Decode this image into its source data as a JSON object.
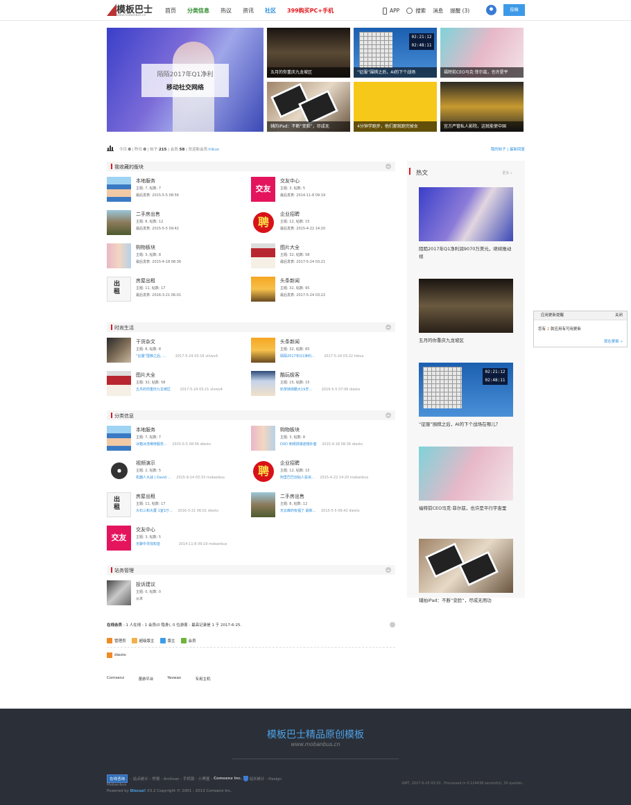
{
  "header": {
    "logo_text": "模板巴士",
    "logo_sub": "www.mobanbus.cn",
    "nav": [
      {
        "label": "首页",
        "style": "normal"
      },
      {
        "label": "分类信息",
        "style": "green"
      },
      {
        "label": "热议",
        "style": "normal"
      },
      {
        "label": "资讯",
        "style": "normal"
      },
      {
        "label": "社区",
        "style": "blue"
      },
      {
        "label": "399购买PC+手机",
        "style": "red"
      }
    ],
    "app_label": "APP",
    "search_label": "搜索",
    "messages_label": "消息",
    "remind_label": "提醒 (3)",
    "post_button": "投稿"
  },
  "hero": {
    "line1": "陌陌2017年Q1净利",
    "line2": "移动社交网络"
  },
  "thumbs": [
    {
      "caption": "五月的你重庆九龙坡区"
    },
    {
      "caption": "“征服”围棋之后，AI的下个战场",
      "clock": "02:21:12",
      "clock2": "02:48:11"
    },
    {
      "caption": "福特前CEO马克·菲尔兹，也许是平"
    },
    {
      "caption": "辅的iPad：不断“变脸”，尽成无"
    },
    {
      "caption": "4分钟学跑步，他们那就跑完掉女"
    },
    {
      "caption": "宜方严管私人影院，这就能使中国"
    }
  ],
  "stats": {
    "today_label": "今日:",
    "today": "0",
    "yesterday_label": "昨日:",
    "yesterday": "0",
    "posts_label": "帖子:",
    "posts": "215",
    "members_label": "会员:",
    "members": "58",
    "welcome_label": "欢迎新会员:",
    "new_member": "hibus",
    "my_posts": "我的帖子",
    "latest_reply": "最新回复"
  },
  "sections": {
    "favorites": {
      "title": "我收藏的版块",
      "forums": [
        {
          "name": "本地服务",
          "meta": "主题: 7, 帖数: 7",
          "meta2": "最后发表: 2015-5-5 08:56"
        },
        {
          "name": "交友中心",
          "meta": "主题: 3, 帖数: 5",
          "meta2": "最后发表: 2014-11-8 09:19"
        },
        {
          "name": "二手房出售",
          "meta": "主题: 8, 帖数: 12",
          "meta2": "最后发表: 2015-5-5 09:42"
        },
        {
          "name": "企业招聘",
          "meta": "主题: 12, 帖数: 15",
          "meta2": "最后发表: 2015-4-22 14:20"
        },
        {
          "name": "购物板块",
          "meta": "主题: 3, 帖数: 8",
          "meta2": "最后发表: 2015-4-18 08:36"
        },
        {
          "name": "图片大全",
          "meta": "主题: 32, 帖数: 58",
          "meta2": "最后发表: 2017-5-24 03:21"
        },
        {
          "name": "房屋出租",
          "meta": "主题: 11, 帖数: 17",
          "meta2": "最后发表: 2016-3-21 06:01"
        },
        {
          "name": "头条新闻",
          "meta": "主题: 32, 帖数: 65",
          "meta2": "最后发表: 2017-5-24 03:22"
        }
      ]
    },
    "fashion": {
      "title": "时尚生活",
      "forums": [
        {
          "name": "干货杂文",
          "meta": "主题: 8, 帖数: 8",
          "link": "“征服”围棋之后, ...",
          "info": "2017-5-24 03:16 vlivev4"
        },
        {
          "name": "头条新闻",
          "meta": "主题: 32, 帖数: 65",
          "link": "陌陌2017年Q1净利...",
          "info": "2017-5-24 03:22 hibus"
        },
        {
          "name": "图片大全",
          "meta": "主题: 32, 帖数: 58",
          "link": "五月的你重庆九龙坡区",
          "info": "2017-5-24 03:21 vlivev4"
        },
        {
          "name": "酷玩极客",
          "meta": "主题: 15, 帖数: 15",
          "link": "奶茶妹妹酷大19岁...",
          "info": "2016-5-5 07:06 diesto"
        }
      ]
    },
    "classified": {
      "title": "分类信息",
      "forums": [
        {
          "name": "本地服务",
          "meta": "主题: 7, 帖数: 7",
          "link": "冰箱冰洗维修服务...",
          "info": "2015-5-5 08:56 diesto"
        },
        {
          "name": "购物板块",
          "meta": "主题: 3, 帖数: 8",
          "link": "DVD 刺绣拼接连帽外套",
          "info": "2015-4-18 08:36 diesto"
        },
        {
          "name": "视频演示",
          "meta": "主题: 2, 帖数: 5",
          "link": "机器人大战 | David ...",
          "info": "2015-9-14 03:33 mobanbus"
        },
        {
          "name": "企业招聘",
          "meta": "主题: 12, 帖数: 15",
          "link": "阿里巴巴创始人投资...",
          "info": "2015-4-22 14:20 mobanbus"
        },
        {
          "name": "房屋出租",
          "meta": "主题: 11, 帖数: 17",
          "link": "大石三和大厦 1室1厅...",
          "info": "2016-3-21 06:01 diesto"
        },
        {
          "name": "二手房出售",
          "meta": "主题: 8, 帖数: 12",
          "link": "天云峰的有福了 最新...",
          "info": "2015-5-5 09:42 diesto"
        },
        {
          "name": "交友中心",
          "meta": "主题: 3, 帖数: 5",
          "link": "无聊中寻找知音",
          "info": "2014-11-8 09:19 mobanbus"
        }
      ]
    },
    "admin": {
      "title": "站务管理",
      "forums": [
        {
          "name": "投诉建议",
          "meta": "主题: 0, 帖数: 0",
          "meta2": "从未"
        }
      ]
    }
  },
  "sidebar": {
    "title": "热文",
    "more": "更多 »",
    "items": [
      {
        "caption": "陌陌2017年Q1净利润9070万美元，继续推动视"
      },
      {
        "caption": "五月的你重庆九龙坡区"
      },
      {
        "caption": "“征服”围棋之后，AI的下个战场在哪儿？"
      },
      {
        "caption": "福特前CEO马克·菲尔兹，也许是平行宇宙里"
      },
      {
        "caption": "辅拍iPad：不断“变脸”，尽成无用功"
      }
    ]
  },
  "popup": {
    "title": "应用更新提醒",
    "close": "关闭",
    "body_pre": "您有",
    "count": "2",
    "body_post": "款应用有可用更新",
    "link": "现在更新 »"
  },
  "online": {
    "text_label": "在线会员",
    "text": "- 1 人在线 - 1 会员(0 隐身), 0 位游客 - 最高记录是 1 于 2017-6-25.",
    "legend": [
      {
        "label": "管理员",
        "color": "#f08a24"
      },
      {
        "label": "超级版主",
        "color": "#f3b048"
      },
      {
        "label": "版主",
        "color": "#3c9be6"
      },
      {
        "label": "会员",
        "color": "#6cb53a"
      }
    ],
    "user": "diesto"
  },
  "friend_links": [
    "Comsenz",
    "漫游平台",
    "Yeswan",
    "专用主机"
  ],
  "footer": {
    "brand": "模板巴士精品原创模板",
    "url": "www.mobanbus.cn",
    "consult": "在线咨询",
    "links": "- 站点统计 - 举报 - Archiver - 手机版 - 小黑屋 -",
    "company": "Comsenz Inc.",
    "stat": "站长统计 - Design",
    "line2": "Mobanbus",
    "powered_pre": "Powered by",
    "discuz": "Discuz!",
    "powered_post": "X3.2 Copyright © 2001 - 2013 Comsenz Inc.",
    "gmt": "GMT, 2017-6-25 03:32 , Processed in 0.124438 second(s), 30 queries ."
  }
}
